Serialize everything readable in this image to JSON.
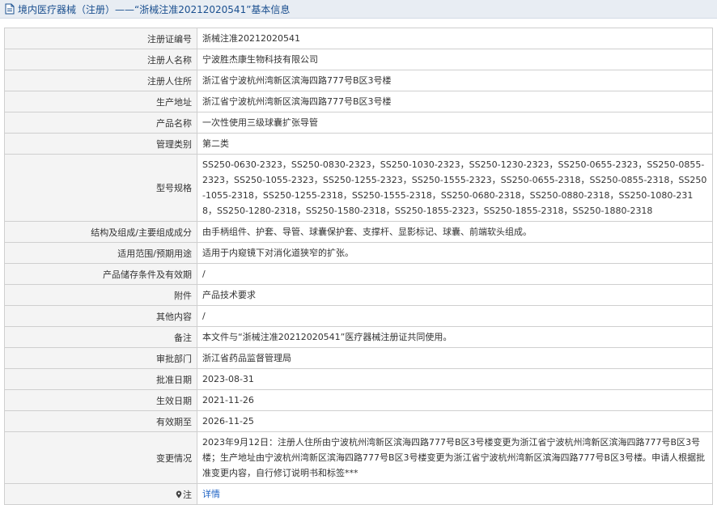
{
  "header": {
    "title": "境内医疗器械（注册）——“浙械注准20212020541”基本信息",
    "icon": "document-icon"
  },
  "rows": [
    {
      "label": "注册证编号",
      "value": "浙械注准20212020541"
    },
    {
      "label": "注册人名称",
      "value": "宁波胜杰康生物科技有限公司"
    },
    {
      "label": "注册人住所",
      "value": "浙江省宁波杭州湾新区滨海四路777号B区3号楼"
    },
    {
      "label": "生产地址",
      "value": "浙江省宁波杭州湾新区滨海四路777号B区3号楼"
    },
    {
      "label": "产品名称",
      "value": "一次性使用三级球囊扩张导管"
    },
    {
      "label": "管理类别",
      "value": "第二类"
    },
    {
      "label": "型号规格",
      "value": "SS250-0630-2323，SS250-0830-2323，SS250-1030-2323，SS250-1230-2323，SS250-0655-2323，SS250-0855-2323，SS250-1055-2323，SS250-1255-2323，SS250-1555-2323，SS250-0655-2318，SS250-0855-2318，SS250-1055-2318，SS250-1255-2318，SS250-1555-2318，SS250-0680-2318，SS250-0880-2318，SS250-1080-2318，SS250-1280-2318，SS250-1580-2318，SS250-1855-2323，SS250-1855-2318，SS250-1880-2318"
    },
    {
      "label": "结构及组成/主要组成成分",
      "value": "由手柄组件、护套、导管、球囊保护套、支撑杆、显影标记、球囊、前端软头组成。"
    },
    {
      "label": "适用范围/预期用途",
      "value": "适用于内窥镜下对消化道狭窄的扩张。"
    },
    {
      "label": "产品储存条件及有效期",
      "value": "/"
    },
    {
      "label": "附件",
      "value": "产品技术要求"
    },
    {
      "label": "其他内容",
      "value": "/"
    },
    {
      "label": "备注",
      "value": "本文件与“浙械注准20212020541”医疗器械注册证共同使用。"
    },
    {
      "label": "审批部门",
      "value": "浙江省药品监督管理局"
    },
    {
      "label": "批准日期",
      "value": "2023-08-31"
    },
    {
      "label": "生效日期",
      "value": "2021-11-26"
    },
    {
      "label": "有效期至",
      "value": "2026-11-25"
    },
    {
      "label": "变更情况",
      "value": "2023年9月12日：注册人住所由宁波杭州湾新区滨海四路777号B区3号楼变更为浙江省宁波杭州湾新区滨海四路777号B区3号楼；生产地址由宁波杭州湾新区滨海四路777号B区3号楼变更为浙江省宁波杭州湾新区滨海四路777号B区3号楼。申请人根据批准变更内容，自行修订说明书和标签***"
    }
  ],
  "note": {
    "label": "注",
    "icon": "pin-icon",
    "link_text": "详情"
  },
  "colors": {
    "link": "#1d62c4",
    "title": "#1a4f8f",
    "label_bg": "#f4f4f4",
    "border": "#cfcfcf"
  }
}
